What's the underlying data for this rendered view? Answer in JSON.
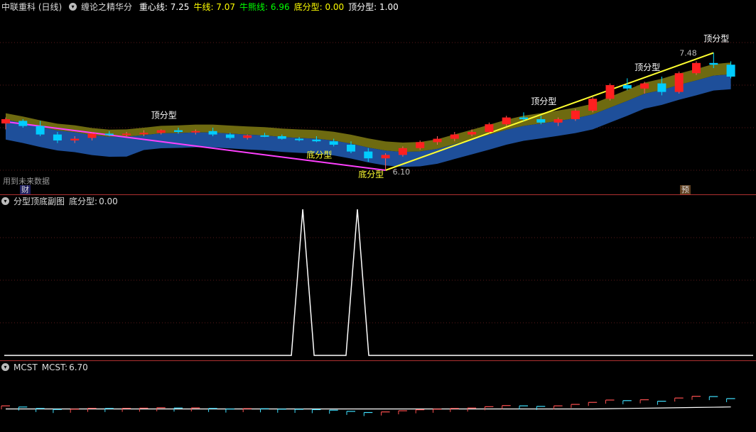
{
  "main": {
    "stock": "中联重科 (日线)",
    "indicator": "缠论之精华分",
    "values": [
      {
        "label": "重心线:",
        "value": "7.25",
        "color": "#ffffff"
      },
      {
        "label": "牛线:",
        "value": "7.07",
        "color": "#ffff00"
      },
      {
        "label": "牛熊线:",
        "value": "6.96",
        "color": "#00ff00"
      },
      {
        "label": "底分型:",
        "value": "0.00",
        "color": "#ffff00"
      },
      {
        "label": "顶分型:",
        "value": "1.00",
        "color": "#ffffff"
      }
    ],
    "future_data_label": "用到未来数据",
    "badge_cai": "财",
    "badge_yu": "预",
    "price_high_label": "7.48",
    "price_low_label": "6.10",
    "fractal_labels": [
      {
        "text": "顶分型",
        "bar": 9,
        "kind": "top"
      },
      {
        "text": "底分型",
        "bar": 18,
        "kind": "bottom"
      },
      {
        "text": "底分型",
        "bar": 21,
        "kind": "bottom"
      },
      {
        "text": "顶分型",
        "bar": 31,
        "kind": "top"
      },
      {
        "text": "顶分型",
        "bar": 37,
        "kind": "top"
      },
      {
        "text": "顶分型",
        "bar": 41,
        "kind": "top"
      }
    ],
    "colors": {
      "up": "#ff2020",
      "down": "#00ccff",
      "band_olive": "#6e6a10",
      "band_blue": "#1e4f9a",
      "trend_pink": "#ff40ff",
      "trend_yellow": "#ffff30"
    }
  },
  "sub1": {
    "title": "分型顶底副图",
    "label": "底分型:",
    "value": "0.00"
  },
  "sub2": {
    "title": "MCST",
    "label": "MCST:",
    "value": "6.70"
  },
  "chart_data": [
    {
      "type": "candlestick",
      "title": "中联重科 (日线)",
      "ylim": [
        6.0,
        7.6
      ],
      "series": [
        {
          "name": "重心线",
          "last": 7.25
        },
        {
          "name": "牛线",
          "last": 7.07
        },
        {
          "name": "牛熊线",
          "last": 6.96
        }
      ],
      "ohlc": [
        [
          6.65,
          6.72,
          6.58,
          6.7
        ],
        [
          6.68,
          6.7,
          6.6,
          6.62
        ],
        [
          6.62,
          6.68,
          6.5,
          6.52
        ],
        [
          6.52,
          6.55,
          6.42,
          6.45
        ],
        [
          6.45,
          6.5,
          6.42,
          6.47
        ],
        [
          6.48,
          6.55,
          6.45,
          6.53
        ],
        [
          6.53,
          6.56,
          6.5,
          6.52
        ],
        [
          6.52,
          6.55,
          6.5,
          6.53
        ],
        [
          6.53,
          6.57,
          6.5,
          6.54
        ],
        [
          6.54,
          6.58,
          6.52,
          6.57
        ],
        [
          6.57,
          6.6,
          6.53,
          6.55
        ],
        [
          6.55,
          6.58,
          6.52,
          6.56
        ],
        [
          6.56,
          6.6,
          6.5,
          6.52
        ],
        [
          6.52,
          6.54,
          6.46,
          6.48
        ],
        [
          6.48,
          6.52,
          6.46,
          6.51
        ],
        [
          6.51,
          6.54,
          6.49,
          6.5
        ],
        [
          6.5,
          6.52,
          6.46,
          6.47
        ],
        [
          6.47,
          6.49,
          6.44,
          6.46
        ],
        [
          6.46,
          6.5,
          6.43,
          6.44
        ],
        [
          6.44,
          6.47,
          6.38,
          6.4
        ],
        [
          6.4,
          6.44,
          6.3,
          6.32
        ],
        [
          6.32,
          6.36,
          6.2,
          6.24
        ],
        [
          6.24,
          6.3,
          6.1,
          6.28
        ],
        [
          6.28,
          6.38,
          6.26,
          6.36
        ],
        [
          6.36,
          6.45,
          6.34,
          6.43
        ],
        [
          6.43,
          6.5,
          6.4,
          6.47
        ],
        [
          6.47,
          6.55,
          6.44,
          6.52
        ],
        [
          6.52,
          6.58,
          6.5,
          6.55
        ],
        [
          6.55,
          6.66,
          6.53,
          6.64
        ],
        [
          6.64,
          6.74,
          6.62,
          6.72
        ],
        [
          6.72,
          6.78,
          6.68,
          6.7
        ],
        [
          6.7,
          6.74,
          6.64,
          6.66
        ],
        [
          6.66,
          6.72,
          6.62,
          6.7
        ],
        [
          6.7,
          6.82,
          6.68,
          6.8
        ],
        [
          6.8,
          6.96,
          6.78,
          6.94
        ],
        [
          6.94,
          7.12,
          6.92,
          7.1
        ],
        [
          7.1,
          7.18,
          7.04,
          7.06
        ],
        [
          7.06,
          7.14,
          7.0,
          7.12
        ],
        [
          7.12,
          7.2,
          6.98,
          7.02
        ],
        [
          7.02,
          7.26,
          7.0,
          7.24
        ],
        [
          7.24,
          7.38,
          7.22,
          7.36
        ],
        [
          7.36,
          7.48,
          7.3,
          7.34
        ],
        [
          7.34,
          7.38,
          7.18,
          7.2
        ]
      ]
    },
    {
      "type": "line",
      "title": "分型顶底副图",
      "series": [
        {
          "name": "底分型",
          "last": 0.0
        }
      ],
      "ylim": [
        0,
        1
      ],
      "values": [
        0,
        0,
        0,
        0,
        0,
        0,
        0,
        0,
        0,
        0,
        0,
        0,
        0,
        0,
        0,
        0,
        0,
        1,
        0,
        0,
        1,
        0,
        0,
        0,
        0,
        0,
        0,
        0,
        0,
        0,
        0,
        0,
        0,
        0,
        0,
        0,
        0,
        0,
        0,
        0,
        0,
        0,
        0
      ]
    },
    {
      "type": "line",
      "title": "MCST",
      "series": [
        {
          "name": "MCST",
          "last": 6.7
        }
      ],
      "ylim": [
        6.2,
        7.4
      ]
    }
  ]
}
